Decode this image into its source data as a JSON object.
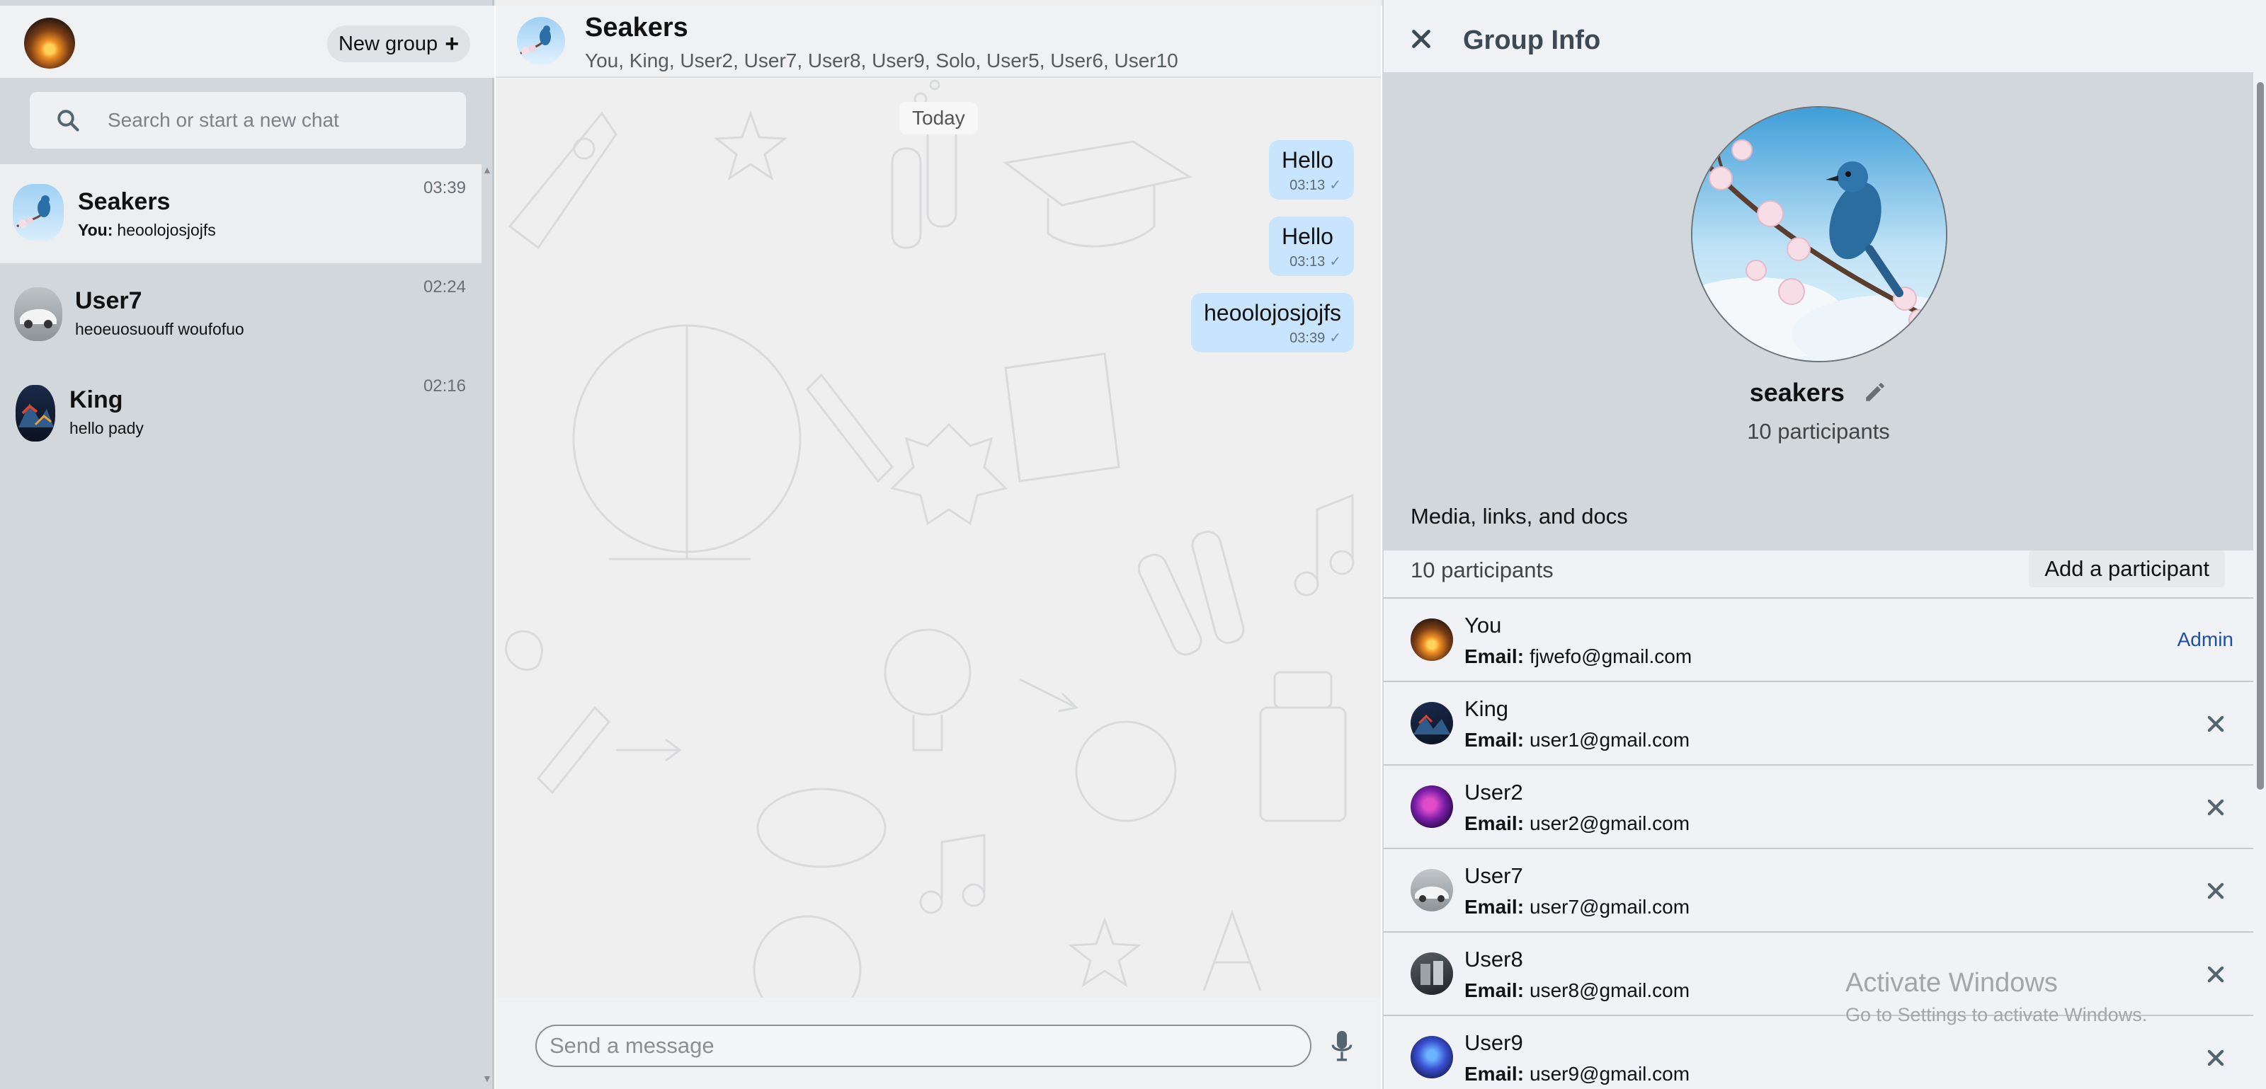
{
  "sidebar": {
    "new_group_label": "New group",
    "new_group_icon": "plus-icon",
    "search": {
      "placeholder": "Search or start a new chat"
    },
    "chats": [
      {
        "name": "Seakers",
        "sender": "You:",
        "preview": "heoolojosjojfs",
        "time": "03:39",
        "active": true
      },
      {
        "name": "User7",
        "sender": "",
        "preview": "heoeuosuouff woufofuo",
        "time": "02:24",
        "active": false
      },
      {
        "name": "King",
        "sender": "",
        "preview": "hello pady",
        "time": "02:16",
        "active": false
      }
    ]
  },
  "chat": {
    "title": "Seakers",
    "members": "You, King, User2, User7, User8, User9, Solo, User5, User6, User10",
    "date_label": "Today",
    "messages": [
      {
        "text": "Hello",
        "time": "03:13",
        "status": "sent"
      },
      {
        "text": "Hello",
        "time": "03:13",
        "status": "sent"
      },
      {
        "text": "heoolojosjojfs",
        "time": "03:39",
        "status": "sent"
      }
    ],
    "composer_placeholder": "Send a message"
  },
  "group_info": {
    "title": "Group Info",
    "group_name": "seakers",
    "participant_summary": "10 participants",
    "media_label": "Media, links, and docs",
    "participants_header": "10 participants",
    "add_participant_label": "Add a participant",
    "email_label": "Email:",
    "participants": [
      {
        "name": "You",
        "email": "fjwefo@gmail.com",
        "role": "Admin"
      },
      {
        "name": "King",
        "email": "user1@gmail.com",
        "role": ""
      },
      {
        "name": "User2",
        "email": "user2@gmail.com",
        "role": ""
      },
      {
        "name": "User7",
        "email": "user7@gmail.com",
        "role": ""
      },
      {
        "name": "User8",
        "email": "user8@gmail.com",
        "role": ""
      },
      {
        "name": "User9",
        "email": "user9@gmail.com",
        "role": ""
      }
    ]
  },
  "watermark": {
    "title": "Activate Windows",
    "subtitle": "Go to Settings to activate Windows."
  },
  "colors": {
    "sidebar_bg": "#d1d7db",
    "outgoing_bubble": "#c9e4fd",
    "admin_link": "#1e50a8"
  }
}
